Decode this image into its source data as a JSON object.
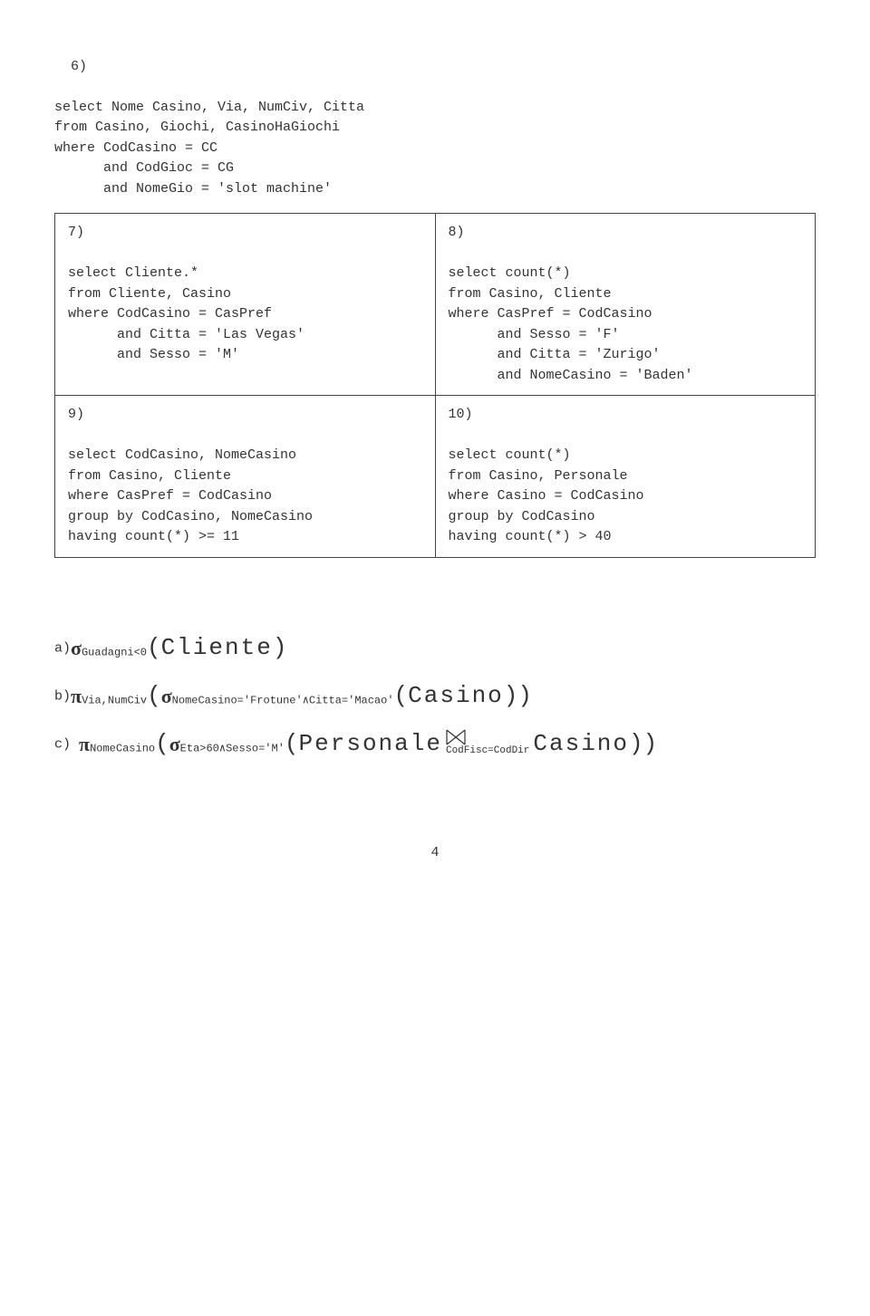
{
  "q6_header": "6)",
  "q6_body": "select Nome Casino, Via, NumCiv, Citta\nfrom Casino, Giochi, CasinoHaGiochi\nwhere CodCasino = CC\n      and CodGioc = CG\n      and NomeGio = 'slot machine'",
  "q7_header": "7)",
  "q7_body": "select Cliente.*\nfrom Cliente, Casino\nwhere CodCasino = CasPref\n      and Citta = 'Las Vegas'\n      and Sesso = 'M'",
  "q8_header": "8)",
  "q8_body": "select count(*)\nfrom Casino, Cliente\nwhere CasPref = CodCasino\n      and Sesso = 'F'\n      and Citta = 'Zurigo'\n      and NomeCasino = 'Baden'",
  "q9_header": "9)",
  "q9_body": "select CodCasino, NomeCasino\nfrom Casino, Cliente\nwhere CasPref = CodCasino\ngroup by CodCasino, NomeCasino\nhaving count(*) >= 11",
  "q10_header": "10)",
  "q10_body": "select count(*)\nfrom Casino, Personale\nwhere Casino = CodCasino\ngroup by CodCasino\nhaving count(*) > 40",
  "ra": {
    "a_label": "a)",
    "a_sub": "Guadagni<0",
    "a_rel": "Cliente",
    "b_label": "b)",
    "b_pi_sub": "Via,NumCiv",
    "b_sigma_sub": "NomeCasino='Frotune'∧Citta='Macao'",
    "b_rel": "Casino",
    "c_label": "c) ",
    "c_pi_sub": "NomeCasino",
    "c_sigma_sub": "Eta>60∧Sesso='M'",
    "c_rel1": "Personale",
    "c_rel2": "Casino",
    "c_join_sub": "CodFisc=CodDir"
  },
  "page": "4"
}
